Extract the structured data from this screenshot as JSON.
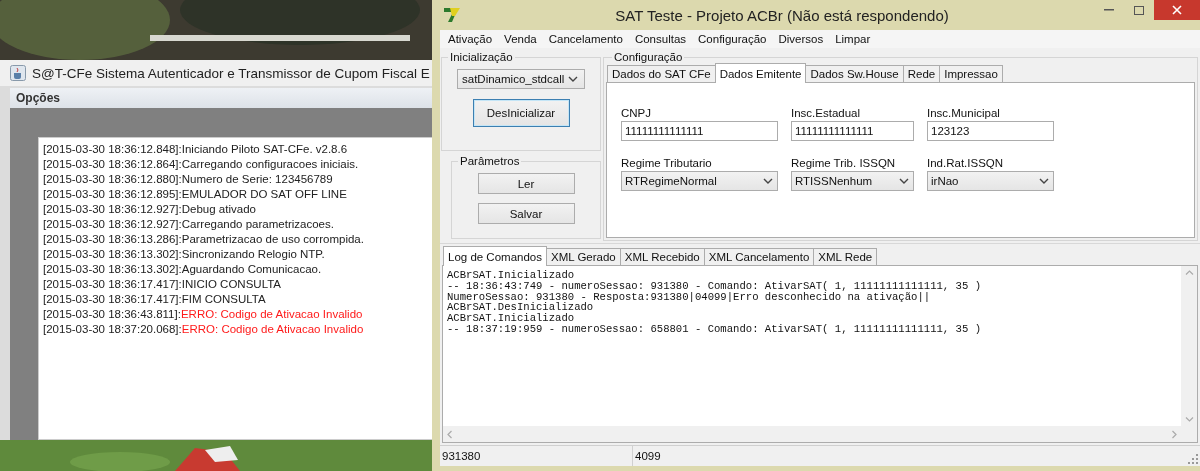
{
  "log_window": {
    "title": "S@T-CFe Sistema Autenticador e Transmissor de Cupom Fiscal E",
    "menu": [
      "Opções"
    ],
    "log": [
      {
        "timestamp": "[2015-03-30 18:36:12.848]:",
        "message": "Iniciando Piloto SAT-CFe. v2.8.6",
        "kind": "info"
      },
      {
        "timestamp": "[2015-03-30 18:36:12.864]:",
        "message": "Carregando configuracoes iniciais.",
        "kind": "info"
      },
      {
        "timestamp": "[2015-03-30 18:36:12.880]:",
        "message": "Numero de Serie: 123456789",
        "kind": "info"
      },
      {
        "timestamp": "[2015-03-30 18:36:12.895]:",
        "message": "EMULADOR DO SAT OFF LINE",
        "kind": "info"
      },
      {
        "timestamp": "[2015-03-30 18:36:12.927]:",
        "message": "Debug ativado",
        "kind": "info"
      },
      {
        "timestamp": "[2015-03-30 18:36:12.927]:",
        "message": "Carregando parametrizacoes.",
        "kind": "info"
      },
      {
        "timestamp": "[2015-03-30 18:36:13.286]:",
        "message": "Parametrizacao de uso corrompida.",
        "kind": "info"
      },
      {
        "timestamp": "[2015-03-30 18:36:13.302]:",
        "message": "Sincronizando Relogio NTP.",
        "kind": "info"
      },
      {
        "timestamp": "[2015-03-30 18:36:13.302]:",
        "message": "Aguardando Comunicacao.",
        "kind": "info"
      },
      {
        "timestamp": "[2015-03-30 18:36:17.417]:",
        "message": "INICIO CONSULTA",
        "kind": "info"
      },
      {
        "timestamp": "[2015-03-30 18:36:17.417]:",
        "message": "FIM CONSULTA",
        "kind": "info"
      },
      {
        "timestamp": "[2015-03-30 18:36:43.811]:",
        "message": "ERRO: Codigo de Ativacao Invalido",
        "kind": "error"
      },
      {
        "timestamp": "[2015-03-30 18:37:20.068]:",
        "message": "ERRO: Codigo de Ativacao Invalido",
        "kind": "error"
      }
    ]
  },
  "main_window": {
    "title": "SAT Teste - Projeto ACBr (Não está respondendo)",
    "menu": [
      "Ativação",
      "Venda",
      "Cancelamento",
      "Consultas",
      "Configuração",
      "Diversos",
      "Limpar"
    ],
    "init_group": {
      "title": "Inicialização",
      "library": "satDinamico_stdcall",
      "button": "DesInicializar",
      "button_focused": true
    },
    "params_group": {
      "title": "Parâmetros",
      "buttons": [
        "Ler",
        "Salvar"
      ]
    },
    "config_group": {
      "title": "Configuração",
      "tabs": [
        {
          "label": "Dados do SAT CFe",
          "selected": false
        },
        {
          "label": "Dados Emitente",
          "selected": true
        },
        {
          "label": "Dados Sw.House",
          "selected": false
        },
        {
          "label": "Rede",
          "selected": false
        },
        {
          "label": "Impressao",
          "selected": false
        }
      ],
      "fields": [
        {
          "label": "CNPJ",
          "value": "11111111111111",
          "kind": "text"
        },
        {
          "label": "Insc.Estadual",
          "value": "11111111111111",
          "kind": "text"
        },
        {
          "label": "Insc.Municipal",
          "value": "123123",
          "kind": "text"
        },
        {
          "label": "Regime Tributario",
          "value": "RTRegimeNormal",
          "kind": "select"
        },
        {
          "label": "Regime Trib. ISSQN",
          "value": "RTISSNenhum",
          "kind": "select"
        },
        {
          "label": "Ind.Rat.ISSQN",
          "value": "irNao",
          "kind": "select"
        }
      ]
    },
    "log_tabs": [
      {
        "label": "Log de Comandos",
        "selected": true
      },
      {
        "label": "XML Gerado",
        "selected": false
      },
      {
        "label": "XML Recebido",
        "selected": false
      },
      {
        "label": "XML Cancelamento",
        "selected": false
      },
      {
        "label": "XML Rede",
        "selected": false
      }
    ],
    "command_log": [
      "ACBrSAT.Inicializado",
      "-- 18:36:43:749 - numeroSessao: 931380 - Comando: AtivarSAT( 1, 11111111111111, 35 )",
      "NumeroSessao: 931380 - Resposta:931380|04099|Erro desconhecido na ativação||",
      "ACBrSAT.DesInicializado",
      "ACBrSAT.Inicializado",
      "-- 18:37:19:959 - numeroSessao: 658801 - Comando: AtivarSAT( 1, 11111111111111, 35 )"
    ],
    "status_bar": [
      "931380",
      "4099"
    ]
  }
}
